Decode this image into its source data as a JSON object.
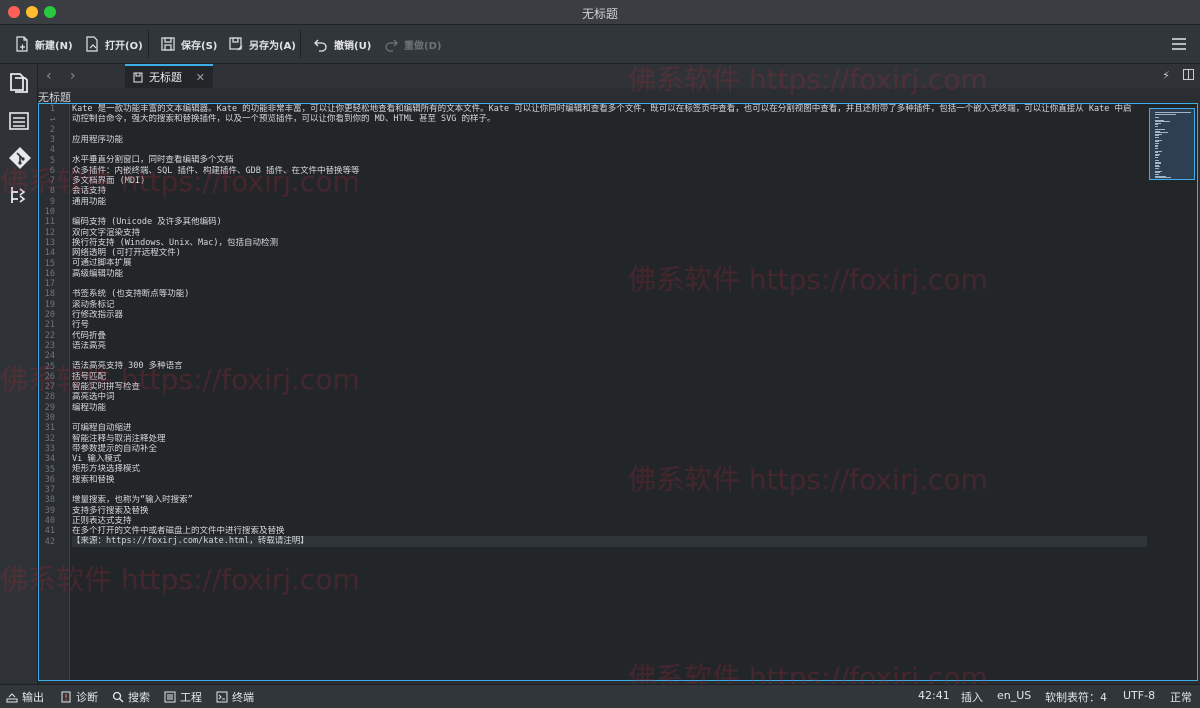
{
  "window": {
    "title": "无标题"
  },
  "toolbar": {
    "new_label": "新建(N)",
    "open_label": "打开(O)",
    "save_label": "保存(S)",
    "save_as_label": "另存为(A)",
    "undo_label": "撤销(U)",
    "redo_label": "重做(D)"
  },
  "tabs": [
    {
      "label": "无标题"
    }
  ],
  "document": {
    "label": "无标题"
  },
  "editor": {
    "lines": [
      "Kate 是一款功能丰富的文本编辑器。Kate 的功能非常丰富，可以让你更轻松地查看和编辑所有的文本文件。Kate 可以让你同时编辑和查看多个文件，既可以在标签页中查看，也可以在分割视图中查看，并且还附带了多种插件，包括一个嵌入式终端，可以让你直接从 Kate 中启",
      "动控制台命令，强大的搜索和替换插件，以及一个预览插件，可以让你看到你的 MD、HTML 甚至 SVG 的样子。",
      "",
      "应用程序功能",
      "",
      "水平垂直分割窗口，同时查看编辑多个文档",
      "众多插件：内嵌终端、SQL 插件、构建插件、GDB 插件、在文件中替换等等",
      "多文档界面 (MDI)",
      "会话支持",
      "通用功能",
      "",
      "编码支持 (Unicode 及许多其他编码)",
      "双向文字渲染支持",
      "换行符支持 (Windows、Unix、Mac)，包括自动检测",
      "网络透明 (可打开远程文件)",
      "可通过脚本扩展",
      "高级编辑功能",
      "",
      "书签系统 (也支持断点等功能)",
      "滚动条标记",
      "行修改指示器",
      "行号",
      "代码折叠",
      "语法高亮",
      "",
      "语法高亮支持 300 多种语言",
      "括号匹配",
      "智能实时拼写检查",
      "高亮选中词",
      "编程功能",
      "",
      "可编程自动缩进",
      "智能注释与取消注释处理",
      "带参数提示的自动补全",
      "Vi 输入模式",
      "矩形方块选择模式",
      "搜索和替换",
      "",
      "增量搜索，也称为“输入时搜索”",
      "支持多行搜索及替换",
      "正则表达式支持",
      "在多个打开的文件中或者磁盘上的文件中进行搜索及替换",
      "【来源：https://foxirj.com/kate.html，转载请注明】"
    ],
    "line_numbers": [
      "1",
      "↵",
      "2",
      "3",
      "4",
      "5",
      "6",
      "7",
      "8",
      "9",
      "10",
      "11",
      "12",
      "13",
      "14",
      "15",
      "16",
      "17",
      "18",
      "19",
      "20",
      "21",
      "22",
      "23",
      "24",
      "25",
      "26",
      "27",
      "28",
      "29",
      "30",
      "31",
      "32",
      "33",
      "34",
      "35",
      "36",
      "37",
      "38",
      "39",
      "40",
      "41",
      "42"
    ]
  },
  "watermark": {
    "text": "佛系软件 https://foxirj.com"
  },
  "statusbar": {
    "output": "输出",
    "diagnostics": "诊断",
    "search": "搜索",
    "project": "工程",
    "terminal": "终端",
    "cursor": "42:41",
    "mode": "插入",
    "language": "en_US",
    "indent": "软制表符：4",
    "encoding": "UTF-8",
    "eol": "正常"
  },
  "colors": {
    "accent": "#3daee9",
    "editor_bg": "#232629",
    "chrome_bg": "#31363b"
  }
}
